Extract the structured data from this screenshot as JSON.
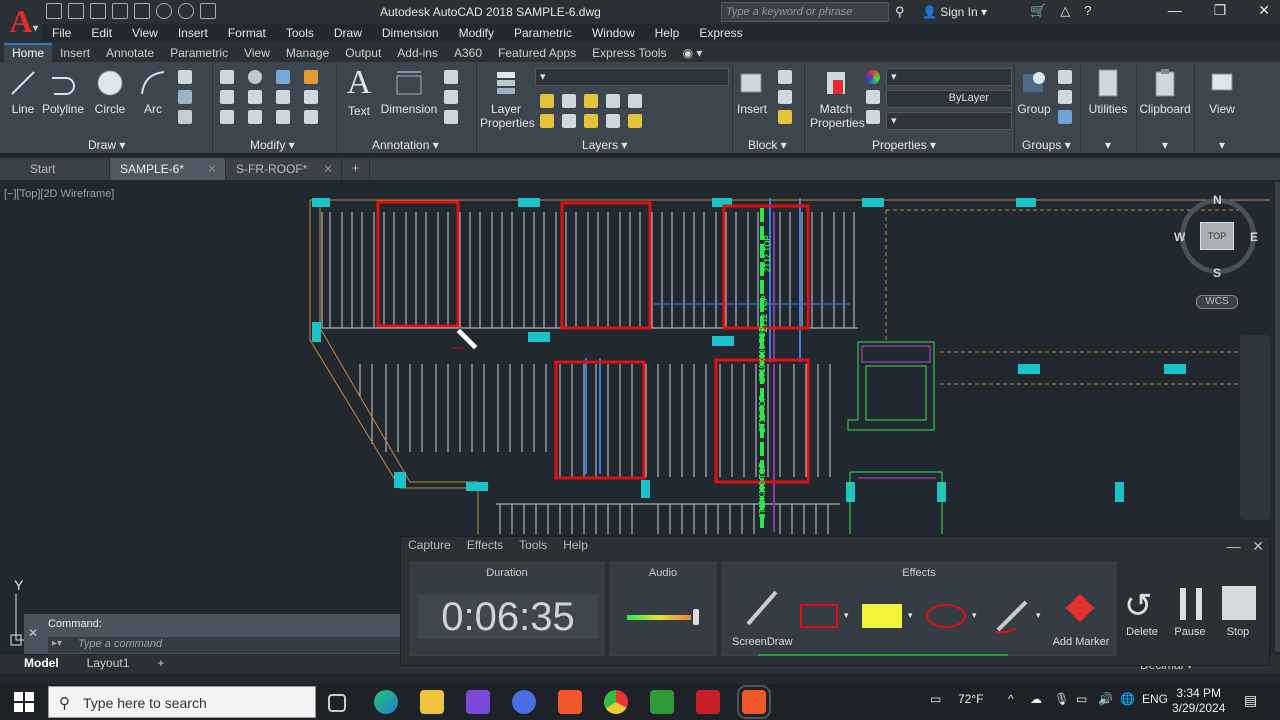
{
  "window": {
    "title": "Autodesk AutoCAD 2018   SAMPLE-6.dwg",
    "search_placeholder": "Type a keyword or phrase",
    "sign_in": "Sign In"
  },
  "menu": [
    "File",
    "Edit",
    "View",
    "Insert",
    "Format",
    "Tools",
    "Draw",
    "Dimension",
    "Modify",
    "Parametric",
    "Window",
    "Help",
    "Express"
  ],
  "ribbon_tabs": [
    "Home",
    "Insert",
    "Annotate",
    "Parametric",
    "View",
    "Manage",
    "Output",
    "Add-ins",
    "A360",
    "Featured Apps",
    "Express Tools"
  ],
  "ribbon": {
    "draw": {
      "line": "Line",
      "polyline": "Polyline",
      "circle": "Circle",
      "arc": "Arc",
      "panel": "Draw"
    },
    "modify_panel": "Modify",
    "annotation": {
      "text": "Text",
      "dimension": "Dimension",
      "panel": "Annotation"
    },
    "layers": {
      "layer_properties_1": "Layer",
      "layer_properties_2": "Properties",
      "panel": "Layers"
    },
    "block": {
      "insert": "Insert",
      "panel": "Block"
    },
    "properties": {
      "match_1": "Match",
      "match_2": "Properties",
      "bylayer": "ByLayer",
      "panel": "Properties"
    },
    "groups": {
      "group": "Group",
      "panel": "Groups"
    },
    "utilities": "Utilities",
    "clipboard": "Clipboard",
    "view": "View"
  },
  "doc_tabs": [
    "Start",
    "SAMPLE-6*",
    "S-FR-ROOF*"
  ],
  "viewport_label": "[−][Top][2D Wireframe]",
  "viewcube": {
    "top": "TOP",
    "n": "N",
    "s": "S",
    "e": "E",
    "w": "W",
    "wcs": "WCS"
  },
  "annotations": {
    "a1": "2T12 TOP",
    "a2": "2T10X300 TOP",
    "a3": "2T12 TOP",
    "a4": "2T12 TOP",
    "a5": "2T10X300 TOP"
  },
  "ucs": {
    "y": "Y"
  },
  "command": {
    "label": "Command:",
    "placeholder": "Type a command"
  },
  "layout_tabs": [
    "Model",
    "Layout1",
    "+"
  ],
  "recorder": {
    "menu": [
      "Capture",
      "Effects",
      "Tools",
      "Help"
    ],
    "duration_label": "Duration",
    "duration": "0:06:35",
    "audio_label": "Audio",
    "effects_label": "Effects",
    "screendraw": "ScreenDraw",
    "add_marker": "Add Marker",
    "delete": "Delete",
    "pause": "Pause",
    "stop": "Stop"
  },
  "statusbar": {
    "decimal": "Decimal"
  },
  "taskbar": {
    "search_placeholder": "Type here to search",
    "weather": "72°F",
    "lang": "ENG",
    "time": "3:34 PM",
    "date": "3/29/2024"
  },
  "colors": {
    "accent": "#2a7fcf",
    "red": "#e01010",
    "green": "#2ee84a",
    "cyan": "#19c3c9",
    "orange": "#c98a3a"
  }
}
